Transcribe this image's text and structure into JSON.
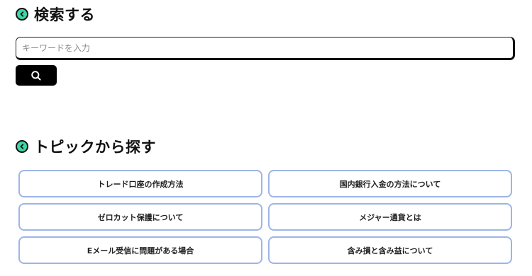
{
  "search_section": {
    "title": "検索する",
    "icon": "chevron-left-circle-icon",
    "input_placeholder": "キーワードを入力",
    "input_value": "",
    "button_icon": "search-icon"
  },
  "topic_section": {
    "title": "トピックから探す",
    "icon": "chevron-left-circle-icon",
    "topics": [
      {
        "label": "トレード口座の作成方法"
      },
      {
        "label": "国内銀行入金の方法について"
      },
      {
        "label": "ゼロカット保護について"
      },
      {
        "label": "メジャー通貨とは"
      },
      {
        "label": "Eメール受信に問題がある場合"
      },
      {
        "label": "含み損と含み益について"
      }
    ]
  },
  "colors": {
    "accent_icon": "#3ed6a6",
    "topic_border": "#9db5e6",
    "button_bg": "#000000"
  }
}
